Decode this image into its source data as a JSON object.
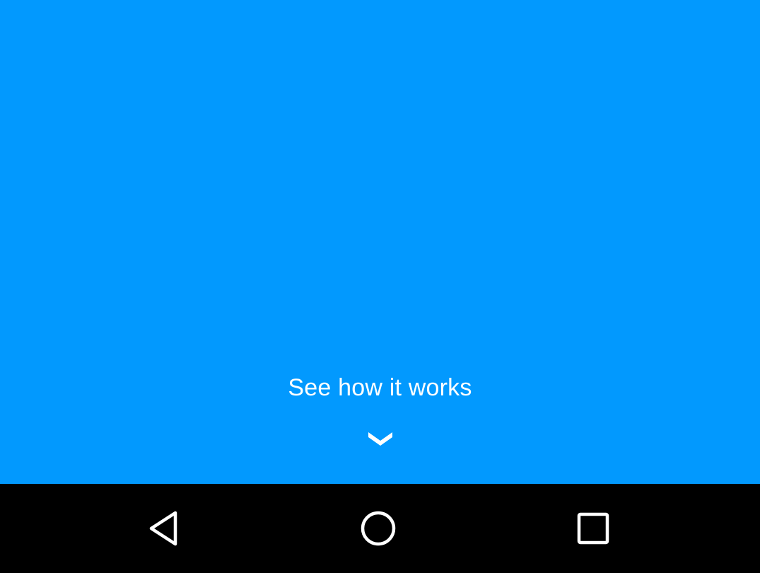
{
  "main": {
    "background_color": "#0299fe",
    "cta": {
      "label": "See how it works",
      "icon": "chevron-down-icon"
    }
  },
  "navigation_bar": {
    "background_color": "#000000",
    "buttons": [
      {
        "name": "back",
        "icon": "back-triangle-icon"
      },
      {
        "name": "home",
        "icon": "home-circle-icon"
      },
      {
        "name": "recents",
        "icon": "recents-square-icon"
      }
    ]
  }
}
